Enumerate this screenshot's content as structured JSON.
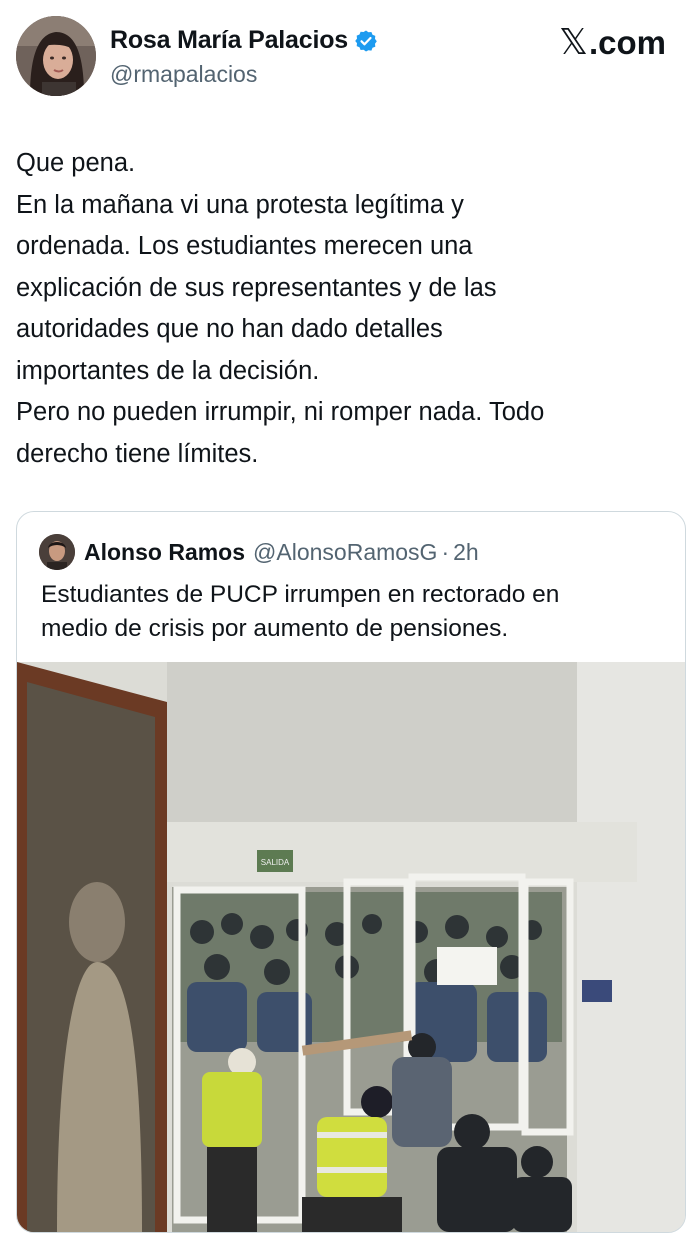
{
  "brand": "X.com",
  "brand_x": "𝕏",
  "brand_suffix": ".com",
  "author": {
    "name": "Rosa María Palacios",
    "handle": "@rmapalacios",
    "verified": true,
    "avatar_icon": "user-avatar"
  },
  "tweet": {
    "lines": [
      "Que pena.",
      "En la mañana vi una protesta legítima y",
      "ordenada. Los estudiantes merecen una",
      "explicación de sus representantes y de las",
      "autoridades que no han dado detalles",
      "importantes de la decisión.",
      "Pero no pueden irrumpir, ni romper nada. Todo",
      "derecho tiene límites."
    ]
  },
  "quote": {
    "name": "Alonso Ramos",
    "handle": "@AlonsoRamosG",
    "separator": "·",
    "time": "2h",
    "lines": [
      "Estudiantes de PUCP  irrumpen en rectorado en",
      "medio de crisis por aumento de pensiones."
    ],
    "media": {
      "sign_text": "SALIDA"
    }
  },
  "colors": {
    "text": "#0f1419",
    "secondary": "#536471",
    "verified_blue": "#1d9bf0",
    "border": "#cfd9de"
  }
}
